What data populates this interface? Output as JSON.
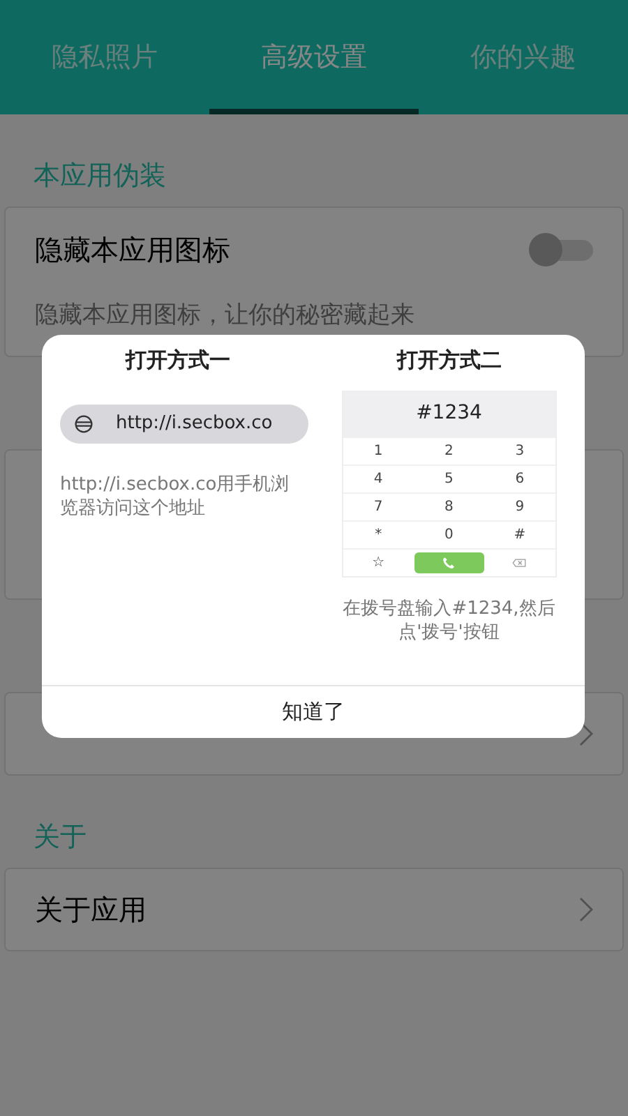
{
  "tabs": [
    {
      "label": "隐私照片",
      "selected": false
    },
    {
      "label": "高级设置",
      "selected": true
    },
    {
      "label": "你的兴趣",
      "selected": false
    }
  ],
  "sections": [
    {
      "title": "本应用伪装",
      "items": [
        {
          "kind": "toggle",
          "title": "隐藏本应用图标",
          "subtitle": "隐藏本应用图标，让你的秘密藏起来",
          "on": false
        }
      ]
    },
    {
      "items": [
        {
          "kind": "covered"
        }
      ]
    },
    {
      "items": [
        {
          "kind": "covered_link"
        }
      ]
    },
    {
      "title": "关于",
      "items": [
        {
          "kind": "link",
          "title": "关于应用"
        }
      ]
    }
  ],
  "dialog": {
    "methods": [
      {
        "kind": "url",
        "title": "打开方式一",
        "url": "http://i.secbox.co",
        "description": "http://i.secbox.co用手机浏览器访问这个地址"
      },
      {
        "kind": "dialer",
        "title": "打开方式二",
        "display": "#1234",
        "keys": [
          "1",
          "2",
          "3",
          "4",
          "5",
          "6",
          "7",
          "8",
          "9",
          "*",
          "0",
          "#",
          "☆"
        ],
        "description": "在拨号盘输入#1234,然后点'拨号'按钮"
      }
    ],
    "button": "知道了"
  }
}
